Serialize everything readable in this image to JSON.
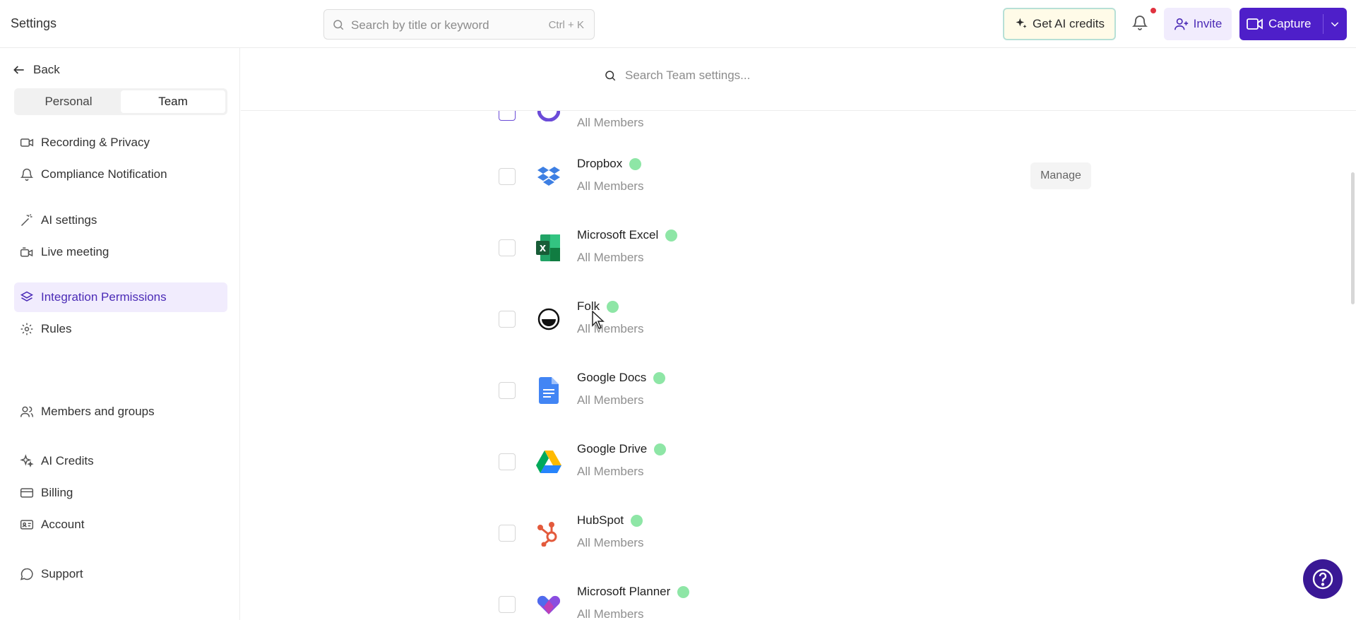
{
  "app": {
    "title": "Settings"
  },
  "search": {
    "placeholder": "Search by title or keyword",
    "shortcut": "Ctrl + K"
  },
  "header": {
    "credits_label": "Get AI credits",
    "invite_label": "Invite",
    "capture_label": "Capture",
    "notification_badge": true
  },
  "sidebar": {
    "back_label": "Back",
    "tabs": [
      {
        "label": "Personal",
        "active": false
      },
      {
        "label": "Team",
        "active": true
      }
    ],
    "items": [
      {
        "label": "Recording & Privacy",
        "icon": "video-icon"
      },
      {
        "label": "Compliance Notification",
        "icon": "bell-icon"
      },
      {
        "label": "AI settings",
        "icon": "magic-wand-icon"
      },
      {
        "label": "Live meeting",
        "icon": "live-video-icon"
      },
      {
        "label": "Integration Permissions",
        "icon": "layers-icon",
        "active": true
      },
      {
        "label": "Rules",
        "icon": "gear-icon"
      },
      {
        "label": "Members and groups",
        "icon": "users-icon"
      },
      {
        "label": "AI Credits",
        "icon": "sparkle-icon"
      },
      {
        "label": "Billing",
        "icon": "credit-card-icon"
      },
      {
        "label": "Account",
        "icon": "id-card-icon"
      },
      {
        "label": "Support",
        "icon": "chat-icon"
      }
    ]
  },
  "main": {
    "search_placeholder": "Search Team settings...",
    "integrations": [
      {
        "name": "",
        "access": "All Members",
        "partial": true
      },
      {
        "name": "Dropbox",
        "access": "All Members",
        "status_color": "#8ee6a6",
        "manage_label": "Manage"
      },
      {
        "name": "Microsoft Excel",
        "access": "All Members",
        "status_color": "#8ee6a6"
      },
      {
        "name": "Folk",
        "access": "All Members",
        "status_color": "#8ee6a6"
      },
      {
        "name": "Google Docs",
        "access": "All Members",
        "status_color": "#8ee6a6"
      },
      {
        "name": "Google Drive",
        "access": "All Members",
        "status_color": "#8ee6a6"
      },
      {
        "name": "HubSpot",
        "access": "All Members",
        "status_color": "#8ee6a6"
      },
      {
        "name": "Microsoft Planner",
        "access": "All Members",
        "status_color": "#8ee6a6"
      }
    ]
  },
  "colors": {
    "accent": "#4e1fc9",
    "accent_light": "#f1ecfd",
    "status_on": "#8ee6a6",
    "help": "#3a1895"
  }
}
